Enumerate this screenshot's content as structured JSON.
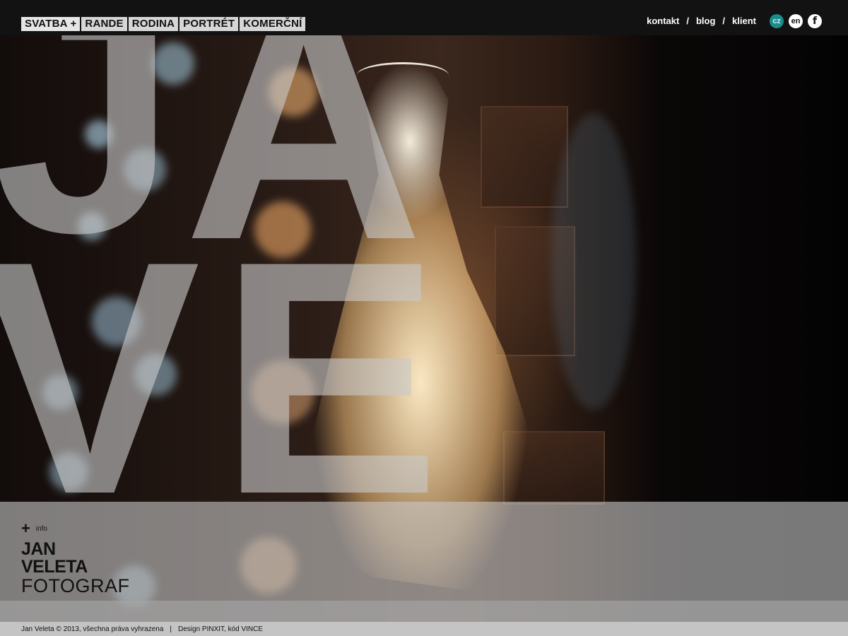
{
  "main_nav": [
    {
      "label": "SVATBA +"
    },
    {
      "label": "RANDE"
    },
    {
      "label": "RODINA"
    },
    {
      "label": "PORTRÉT"
    },
    {
      "label": "KOMERČNÍ"
    }
  ],
  "util_nav": [
    {
      "label": "kontakt"
    },
    {
      "label": "blog"
    },
    {
      "label": "klient"
    }
  ],
  "util_separator": "/",
  "languages": [
    {
      "label": "cz",
      "active": true
    },
    {
      "label": "en",
      "active": false
    }
  ],
  "social": {
    "facebook_glyph": "f",
    "icon": "facebook-icon"
  },
  "hero": {
    "letters": [
      "J",
      "A",
      "V",
      "E"
    ]
  },
  "info": {
    "plus_glyph": "+",
    "label": "info"
  },
  "logo": {
    "line1": "JAN",
    "line2": "VELETA",
    "line3": "FOTOGRAF"
  },
  "footer": {
    "copyright": "Jan Veleta © 2013, všechna práva vyhrazena",
    "separator": "|",
    "credits": "Design PINXIT, kód VINCE"
  },
  "colors": {
    "topbar": "#121212",
    "nav_bg": "#d6d6d6",
    "lang_active": "#1a8c8c",
    "band": "#c8c8c8",
    "footer": "#c4c4c4"
  }
}
